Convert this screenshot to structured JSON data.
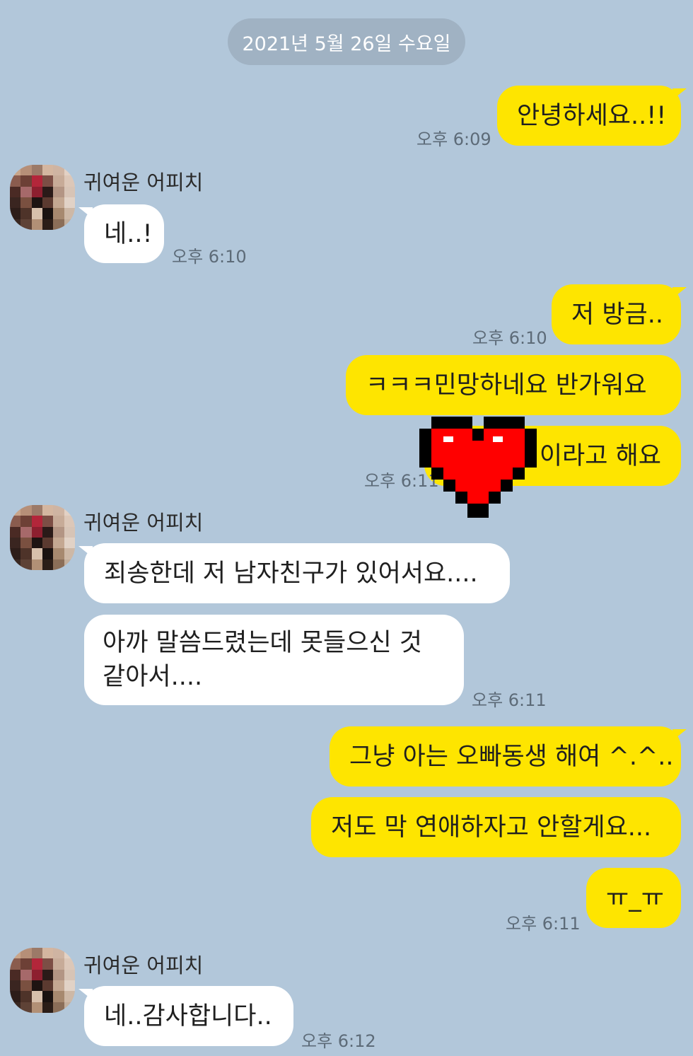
{
  "date_divider": "2021년 5월 26일 수요일",
  "contact_name": "귀여운 어피치",
  "messages": {
    "m1": "안녕하세요..!!",
    "t1": "오후 6:09",
    "m2": "네..!",
    "t2": "오후 6:10",
    "m3": "저 방금..",
    "t3": "오후 6:10",
    "m4": "ㅋㅋㅋ민망하네요 반가워요",
    "m5": "이라고 해요",
    "t5": "오후 6:11",
    "m6": "죄송한데 저 남자친구가 있어서요....",
    "m7": "아까 말씀드렸는데 못들으신 것 같아서....",
    "t7": "오후 6:11",
    "m8": "그냥 아는 오빠동생 해여 ^.^..",
    "m9": "저도 막 연애하자고 안할게요...",
    "m10": "ㅠ_ㅠ",
    "t10": "오후 6:11",
    "m11": "네..감사합니다..",
    "t11": "오후 6:12"
  },
  "colors": {
    "background": "#b2c7da",
    "my_bubble": "#fee500",
    "their_bubble": "#ffffff",
    "heart_sticker": "#ff0000"
  },
  "icons": {
    "avatar": "pixelated-profile-avatar",
    "sticker": "pixel-heart-sticker"
  }
}
